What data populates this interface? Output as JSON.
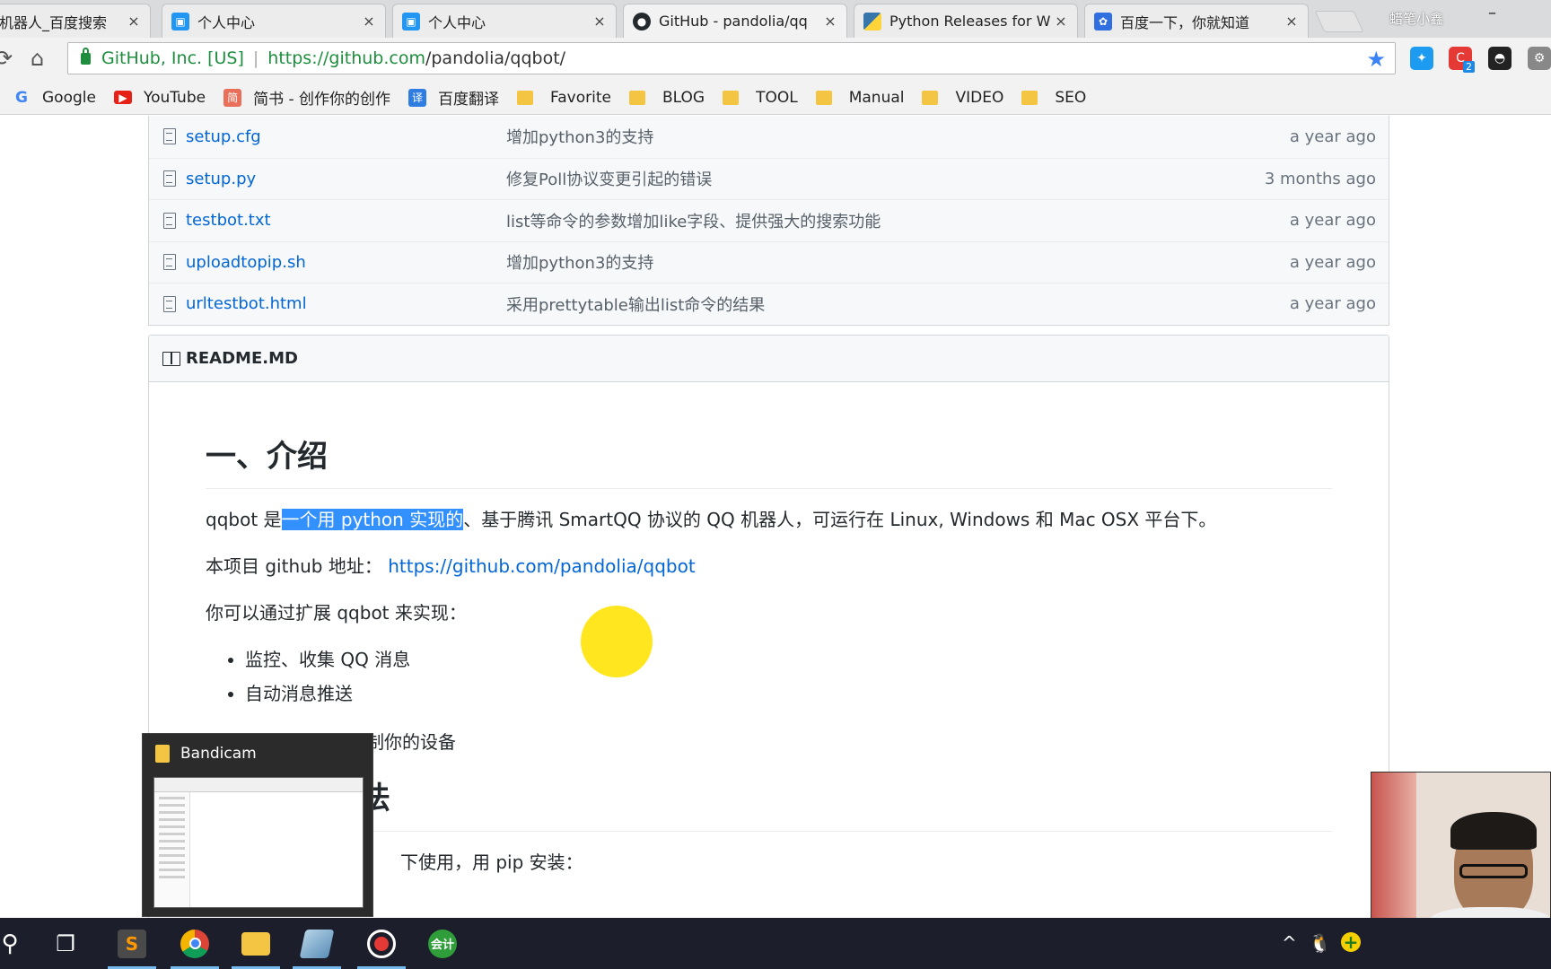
{
  "browser": {
    "tabs": [
      {
        "title": "机器人_百度搜索",
        "close": "×",
        "icon": "baidu-icon"
      },
      {
        "title": "个人中心",
        "close": "×",
        "icon": "picture-icon"
      },
      {
        "title": "个人中心",
        "close": "×",
        "icon": "picture-icon"
      },
      {
        "title": "GitHub - pandolia/qq",
        "close": "×",
        "icon": "github-icon"
      },
      {
        "title": "Python Releases for W",
        "close": "×",
        "icon": "python-icon"
      },
      {
        "title": "百度一下，你就知道",
        "close": "×",
        "icon": "baidu-paw-icon"
      }
    ],
    "profile_name": "蜡笔小鑫",
    "minimize": "–",
    "address": {
      "secure_label": "GitHub, Inc. [US]",
      "separator": "|",
      "url_scheme_host": "https://github.com",
      "url_path": "/pandolia/qqbot/"
    },
    "extension_badge": "2",
    "bookmarks": [
      {
        "label": "Google",
        "icon": "google-icon"
      },
      {
        "label": "YouTube",
        "icon": "youtube-icon"
      },
      {
        "label": "简书 - 创作你的创作",
        "icon": "jianshu-icon",
        "glyph": "简"
      },
      {
        "label": "百度翻译",
        "icon": "translate-icon",
        "glyph": "译"
      },
      {
        "label": "Favorite",
        "icon": "folder-icon"
      },
      {
        "label": "BLOG",
        "icon": "folder-icon"
      },
      {
        "label": "TOOL",
        "icon": "folder-icon"
      },
      {
        "label": "Manual",
        "icon": "folder-icon"
      },
      {
        "label": "VIDEO",
        "icon": "folder-icon"
      },
      {
        "label": "SEO",
        "icon": "folder-icon"
      }
    ]
  },
  "files": [
    {
      "name": "setup.cfg",
      "message": "增加python3的支持",
      "age": "a year ago"
    },
    {
      "name": "setup.py",
      "message": "修复Poll协议变更引起的错误",
      "age": "3 months ago"
    },
    {
      "name": "testbot.txt",
      "message": "list等命令的参数增加like字段、提供强大的搜索功能",
      "age": "a year ago"
    },
    {
      "name": "uploadtopip.sh",
      "message": "增加python3的支持",
      "age": "a year ago"
    },
    {
      "name": "urltestbot.html",
      "message": "采用prettytable输出list命令的结果",
      "age": "a year ago"
    }
  ],
  "readme": {
    "header": "README.MD",
    "h1": "一、介绍",
    "intro_before": "qqbot 是",
    "intro_selected": "一个用 python 实现的",
    "intro_after": "、基于腾讯 SmartQQ 协议的 QQ 机器人，可运行在 Linux, Windows 和 Mac OSX 平台下。",
    "repo_prefix": "本项目 github 地址：",
    "repo_link": "https://github.com/pandolia/qqbot",
    "extend_text": "你可以通过扩展 qqbot 来实现：",
    "bullets": [
      "监控、收集 QQ 消息",
      "自动消息推送"
    ],
    "partial_line": "控制你的设备",
    "h2_partial": "法",
    "partial_bottom": "下使用，用 pip 安装："
  },
  "preview": {
    "title": "Bandicam"
  },
  "taskbar": {
    "items": [
      {
        "icon": "search-icon",
        "glyph": "⚲"
      },
      {
        "icon": "task-view-icon",
        "glyph": "❐"
      },
      {
        "icon": "sublime-text-icon",
        "glyph": "S"
      },
      {
        "icon": "chrome-icon",
        "glyph": ""
      },
      {
        "icon": "file-explorer-icon",
        "glyph": ""
      },
      {
        "icon": "notes-icon",
        "glyph": ""
      },
      {
        "icon": "bandicam-record-icon",
        "glyph": ""
      },
      {
        "icon": "accounting-app-icon",
        "glyph": "会计"
      }
    ],
    "tray": [
      {
        "icon": "chevron-up-icon",
        "glyph": "^"
      },
      {
        "icon": "qq-icon",
        "glyph": "🐧"
      },
      {
        "icon": "plus-circle-icon",
        "glyph": "+"
      }
    ]
  },
  "colors": {
    "link": "#0366d6",
    "selection": "#3390ff",
    "cursor_highlight": "#ffe200",
    "secure_green": "#1e8e3e"
  }
}
